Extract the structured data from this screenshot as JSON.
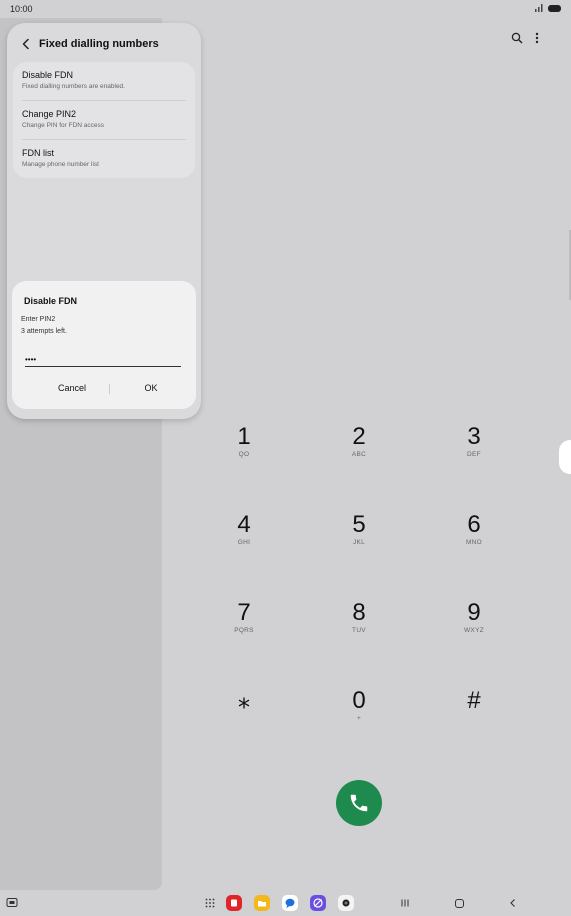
{
  "status_bar": {
    "time": "10:00"
  },
  "popup": {
    "title": "Fixed dialling numbers",
    "items": [
      {
        "title": "Disable FDN",
        "subtitle": "Fixed dialling numbers are enabled."
      },
      {
        "title": "Change PIN2",
        "subtitle": "Change PIN for FDN access"
      },
      {
        "title": "FDN list",
        "subtitle": "Manage phone number list"
      }
    ]
  },
  "dialog": {
    "title": "Disable FDN",
    "message_line1": "Enter PIN2",
    "message_line2": "3 attempts left.",
    "pin_value": "••••",
    "cancel_label": "Cancel",
    "ok_label": "OK"
  },
  "keypad": {
    "keys": [
      {
        "digit": "1",
        "letters": "QO"
      },
      {
        "digit": "2",
        "letters": "ABC"
      },
      {
        "digit": "3",
        "letters": "DEF"
      },
      {
        "digit": "4",
        "letters": "GHI"
      },
      {
        "digit": "5",
        "letters": "JKL"
      },
      {
        "digit": "6",
        "letters": "MNO"
      },
      {
        "digit": "7",
        "letters": "PQRS"
      },
      {
        "digit": "8",
        "letters": "TUV"
      },
      {
        "digit": "9",
        "letters": "WXYZ"
      },
      {
        "digit": "⁎",
        "letters": ""
      },
      {
        "digit": "0",
        "letters": "+"
      },
      {
        "digit": "#",
        "letters": ""
      }
    ]
  },
  "icons": {
    "search": "search-icon",
    "more": "more-options-icon",
    "call": "phone-icon"
  },
  "colors": {
    "call_button": "#1f8a4d",
    "background": "#d1d1d3"
  }
}
